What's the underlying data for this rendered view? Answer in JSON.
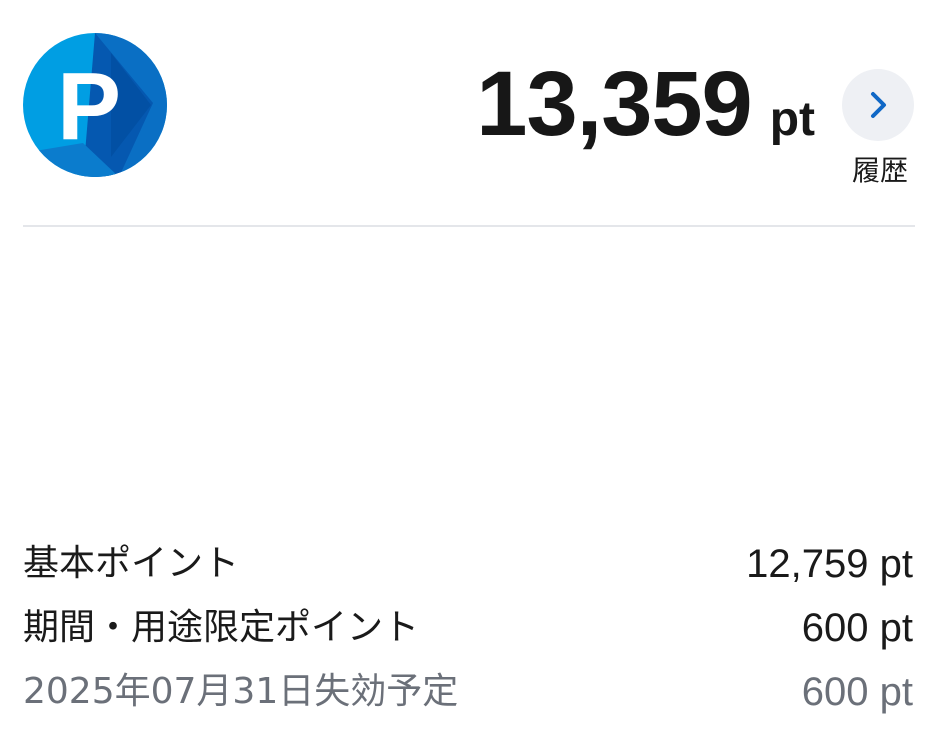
{
  "logo": {
    "letter": "P",
    "icon": "point-logo-icon"
  },
  "balance": {
    "value": "13,359",
    "unit": "pt"
  },
  "history": {
    "label": "履歴",
    "icon": "chevron-right-icon"
  },
  "breakdown": {
    "rows": [
      {
        "label": "基本ポイント",
        "value": "12,759 pt"
      },
      {
        "label": "期間・用途限定ポイント",
        "value": "600 pt"
      },
      {
        "label": "2025年07月31日失効予定",
        "value": "600 pt"
      }
    ]
  },
  "colors": {
    "brand_blue_light": "#00a0e6",
    "brand_blue_dark": "#0054a6",
    "chevron": "#1068c6",
    "muted_text": "#6b7079"
  }
}
